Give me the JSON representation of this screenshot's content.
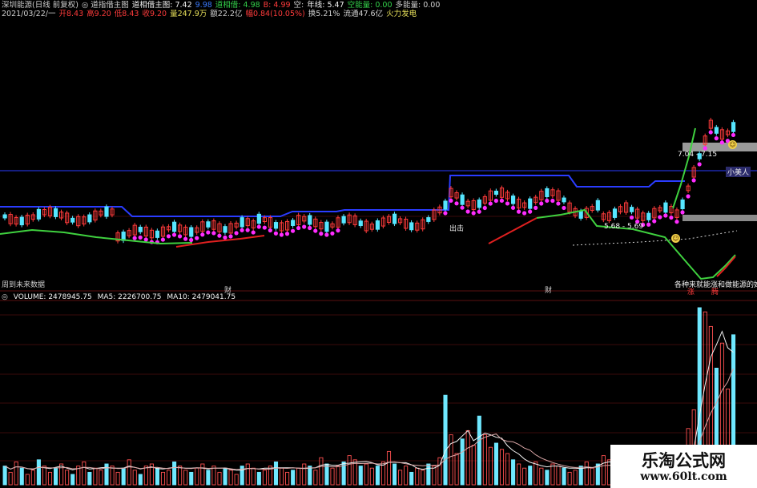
{
  "header": {
    "row1": [
      {
        "text": "深圳能源(日线 前复权)",
        "color": "grey"
      },
      {
        "text": "◎ 道指借主图",
        "color": "grey"
      },
      {
        "text": "道相借主图: 7.42",
        "color": "white"
      },
      {
        "text": "9.98",
        "color": "blue"
      },
      {
        "text": "道相借: 4.98",
        "color": "green"
      },
      {
        "text": "B: 4.99",
        "color": "red"
      },
      {
        "text": "空:",
        "color": "grey"
      },
      {
        "text": "年线: 5.47",
        "color": "white"
      },
      {
        "text": "空能量: 0.00",
        "color": "green"
      },
      {
        "text": "多能量: 0.00",
        "color": "grey"
      }
    ],
    "row2": [
      {
        "text": "2021/03/22/一",
        "color": "grey"
      },
      {
        "text": "开8.43",
        "color": "red"
      },
      {
        "text": "高9.20",
        "color": "red"
      },
      {
        "text": "低8.43",
        "color": "red"
      },
      {
        "text": "收9.20",
        "color": "red"
      },
      {
        "text": "量247.9万",
        "color": "yel"
      },
      {
        "text": "额22.2亿",
        "color": "grey"
      },
      {
        "text": "幅0.84(10.05%)",
        "color": "red"
      },
      {
        "text": "换5.21%",
        "color": "grey"
      },
      {
        "text": "流通47.6亿",
        "color": "grey"
      },
      {
        "text": "火力发电",
        "color": "yel"
      }
    ]
  },
  "annotations": {
    "xiaomeiren": "小美人",
    "range_top": "7.04 - 7.15",
    "range_mid": "5.68 - 5.69",
    "chuji": "出击",
    "future_note": "周到未来数据",
    "bottom_note": "各种来就能涨和做能源的好",
    "cai1": "财",
    "cai2": "财",
    "zhang": "涨",
    "teng": "腾"
  },
  "volume_header": {
    "volume": "VOLUME: 2478945.75",
    "ma5": "MA5: 2226700.75",
    "ma10": "MA10: 2479041.75"
  },
  "watermark": {
    "title": "乐淘公式网",
    "url": "www.60lt.com"
  },
  "colors": {
    "up_candle": "#ff3b3b",
    "down_candle": "#56e6ff",
    "resistance_line": "#2a3cff",
    "magenta_dots": "#ff2cff",
    "trend_green": "#3fd13f",
    "trend_red": "#e02020",
    "volume_up": "#ff5050",
    "volume_down": "#6fe8ff"
  },
  "chart_data": {
    "type": "bar",
    "title": "",
    "series": [
      {
        "name": "VOLUME",
        "values": [
          0.9,
          0.6,
          1.1,
          0.8,
          0.5,
          0.7,
          1.2,
          0.9,
          0.6,
          0.8,
          1.0,
          0.7,
          0.5,
          0.9,
          1.1,
          0.6,
          0.8,
          0.7,
          1.0,
          0.9,
          0.6,
          0.8,
          1.2,
          0.7,
          0.5,
          0.9,
          1.0,
          0.8,
          0.6,
          0.7,
          1.1,
          0.9,
          0.7,
          0.6,
          0.8,
          1.0,
          0.7,
          0.9,
          0.6,
          0.8,
          0.7,
          0.5,
          0.9,
          1.0,
          0.8,
          0.6,
          0.7,
          0.9,
          1.1,
          0.8,
          0.6,
          0.7,
          0.8,
          1.0,
          0.9,
          0.7,
          1.3,
          1.0,
          0.8,
          0.9,
          1.1,
          1.4,
          1.2,
          0.9,
          1.0,
          0.8,
          0.9,
          1.1,
          1.6,
          1.0,
          0.7,
          0.9,
          0.6,
          0.8,
          0.7,
          1.0,
          0.9,
          1.3,
          4.3,
          2.4,
          1.5,
          2.2,
          2.6,
          1.9,
          3.3,
          2.4,
          1.8,
          2.0,
          1.7,
          1.5,
          1.2,
          1.0,
          0.8,
          0.9,
          1.1,
          0.8,
          0.7,
          1.0,
          0.9,
          0.8,
          0.6,
          0.7,
          0.9,
          1.1,
          0.8,
          1.0,
          1.4,
          1.2,
          0.9,
          1.0,
          1.2,
          0.9,
          0.8,
          0.7,
          0.9,
          1.0,
          0.8,
          0.7,
          0.6,
          0.8,
          0.9,
          2.7,
          3.6,
          8.5,
          8.3,
          7.6,
          5.6,
          6.8,
          4.6,
          7.2
        ]
      },
      {
        "name": "MA5",
        "values": []
      },
      {
        "name": "MA10",
        "values": []
      }
    ]
  }
}
